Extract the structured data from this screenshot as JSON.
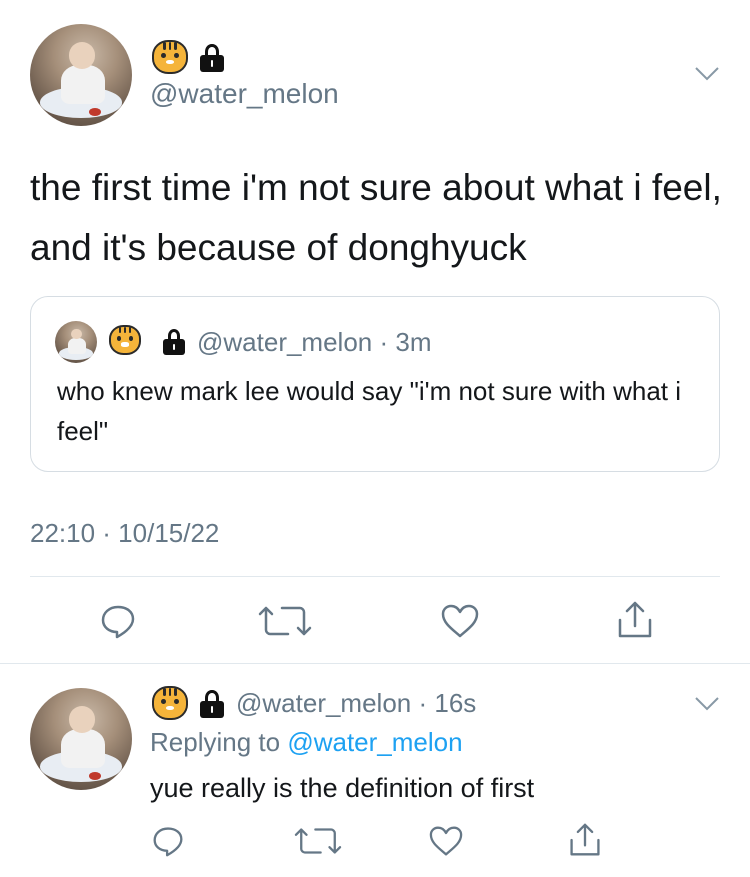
{
  "main_tweet": {
    "handle": "@water_melon",
    "text": "the first time i'm not sure about what i feel, and it's because of donghyuck",
    "timestamp": "22:10 · 10/15/22"
  },
  "quoted_tweet": {
    "handle": "@water_melon",
    "time": " · 3m",
    "text": "who knew mark lee would say \"i'm not sure with what i feel\""
  },
  "reply_tweet": {
    "handle": "@water_melon",
    "time": " · 16s",
    "replying_prefix": "Replying to ",
    "replying_handle": "@water_melon",
    "text": "yue really is the definition of first"
  },
  "icons": {
    "emoji": "tiger-face-icon",
    "protected": "lock-icon",
    "more": "chevron-down-icon",
    "actions": [
      "reply-icon",
      "retweet-icon",
      "like-icon",
      "share-icon"
    ]
  },
  "colors": {
    "text": "#14171a",
    "secondary": "#657786",
    "link": "#1da1f2",
    "border": "#e1e8ed"
  }
}
